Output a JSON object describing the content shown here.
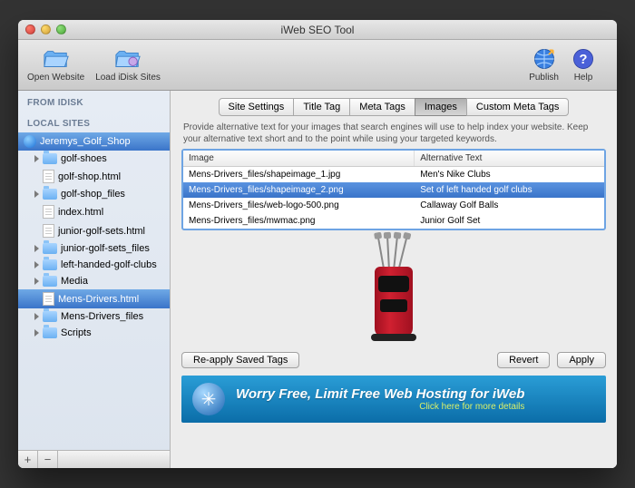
{
  "window": {
    "title": "iWeb SEO Tool"
  },
  "toolbar": {
    "open_website": "Open Website",
    "load_idisk": "Load iDisk Sites",
    "publish": "Publish",
    "help": "Help"
  },
  "sidebar": {
    "heading_idisk": "FROM IDISK",
    "heading_local": "LOCAL SITES",
    "site_name": "Jeremys_Golf_Shop",
    "items": [
      {
        "label": "golf-shoes",
        "type": "folder"
      },
      {
        "label": "golf-shop.html",
        "type": "file"
      },
      {
        "label": "golf-shop_files",
        "type": "folder"
      },
      {
        "label": "index.html",
        "type": "file"
      },
      {
        "label": "junior-golf-sets.html",
        "type": "file"
      },
      {
        "label": "junior-golf-sets_files",
        "type": "folder"
      },
      {
        "label": "left-handed-golf-clubs",
        "type": "folder"
      },
      {
        "label": "Media",
        "type": "folder"
      },
      {
        "label": "Mens-Drivers.html",
        "type": "file",
        "selected": true
      },
      {
        "label": "Mens-Drivers_files",
        "type": "folder"
      },
      {
        "label": "Scripts",
        "type": "folder"
      }
    ],
    "add": "+",
    "remove": "−"
  },
  "tabs": {
    "site_settings": "Site Settings",
    "title_tag": "Title Tag",
    "meta_tags": "Meta Tags",
    "images": "Images",
    "custom_meta": "Custom Meta Tags"
  },
  "hint": "Provide alternative text for your images that search engines will use to help index your website. Keep your alternative text short and to the point while using your targeted keywords.",
  "table": {
    "col_image": "Image",
    "col_alt": "Alternative Text",
    "rows": [
      {
        "img": "Mens-Drivers_files/shapeimage_1.jpg",
        "alt": "Men's Nike Clubs"
      },
      {
        "img": "Mens-Drivers_files/shapeimage_2.png",
        "alt": "Set of left handed golf clubs",
        "selected": true
      },
      {
        "img": "Mens-Drivers_files/web-logo-500.png",
        "alt": "Callaway Golf Balls"
      },
      {
        "img": "Mens-Drivers_files/mwmac.png",
        "alt": "Junior Golf Set"
      }
    ]
  },
  "buttons": {
    "reapply": "Re-apply Saved Tags",
    "revert": "Revert",
    "apply": "Apply"
  },
  "ad": {
    "title": "Worry Free, Limit Free Web Hosting for iWeb",
    "subtitle": "Click here for more details"
  }
}
